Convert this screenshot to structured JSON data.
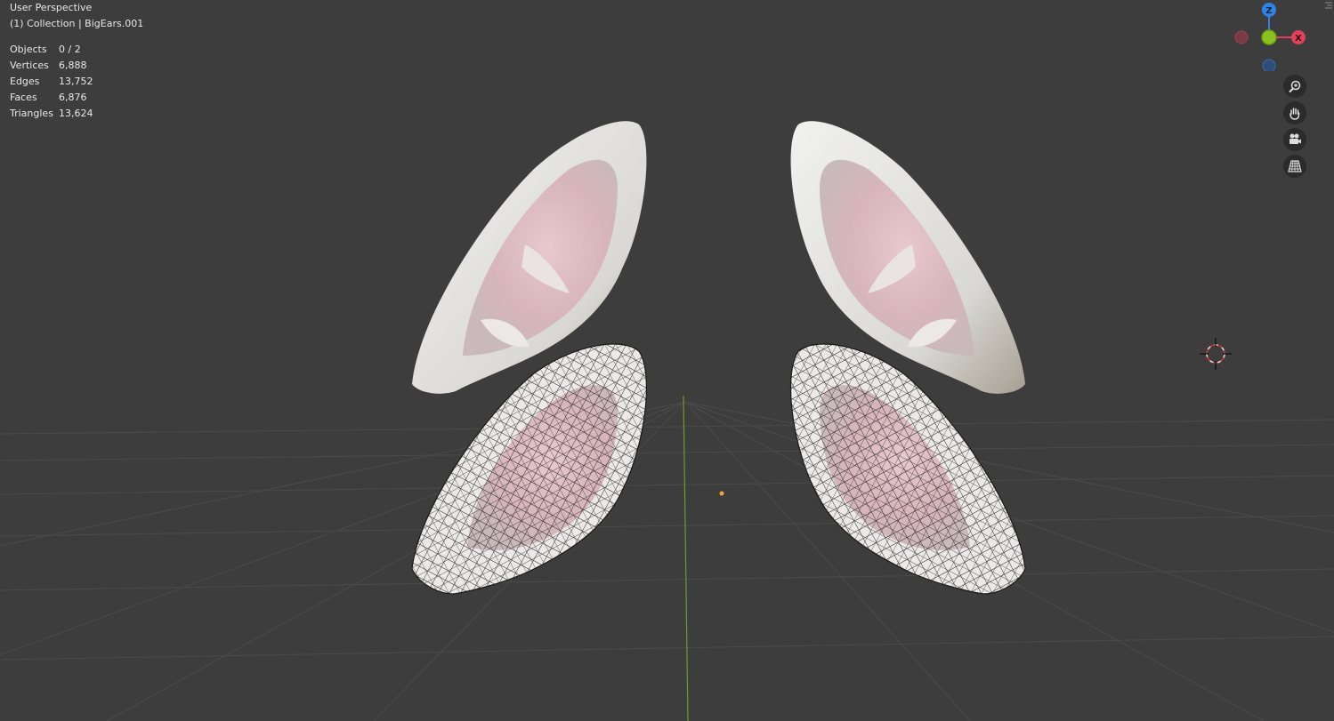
{
  "viewport": {
    "view_name": "User Perspective",
    "collection_line": "(1) Collection | BigEars.001"
  },
  "stats": [
    {
      "label": "Objects",
      "value": "0 / 2"
    },
    {
      "label": "Vertices",
      "value": "6,888"
    },
    {
      "label": "Edges",
      "value": "13,752"
    },
    {
      "label": "Faces",
      "value": "6,876"
    },
    {
      "label": "Triangles",
      "value": "13,624"
    }
  ],
  "gizmo": {
    "z_label": "Z",
    "x_label": "X",
    "colors": {
      "x": "#e0415a",
      "y": "#8cc21e",
      "z": "#2f83e6",
      "bg": "#3d3d3d",
      "grid": "#4a4a4a",
      "grid_y_axis": "#6f9b2a"
    }
  },
  "nav_buttons": [
    {
      "name": "zoom-icon"
    },
    {
      "name": "pan-hand-icon"
    },
    {
      "name": "camera-view-icon"
    },
    {
      "name": "perspective-grid-icon"
    }
  ],
  "objects": [
    {
      "name": "BigEars solid left"
    },
    {
      "name": "BigEars solid right"
    },
    {
      "name": "BigEars.001 wireframe left"
    },
    {
      "name": "BigEars.001 wireframe right"
    }
  ]
}
